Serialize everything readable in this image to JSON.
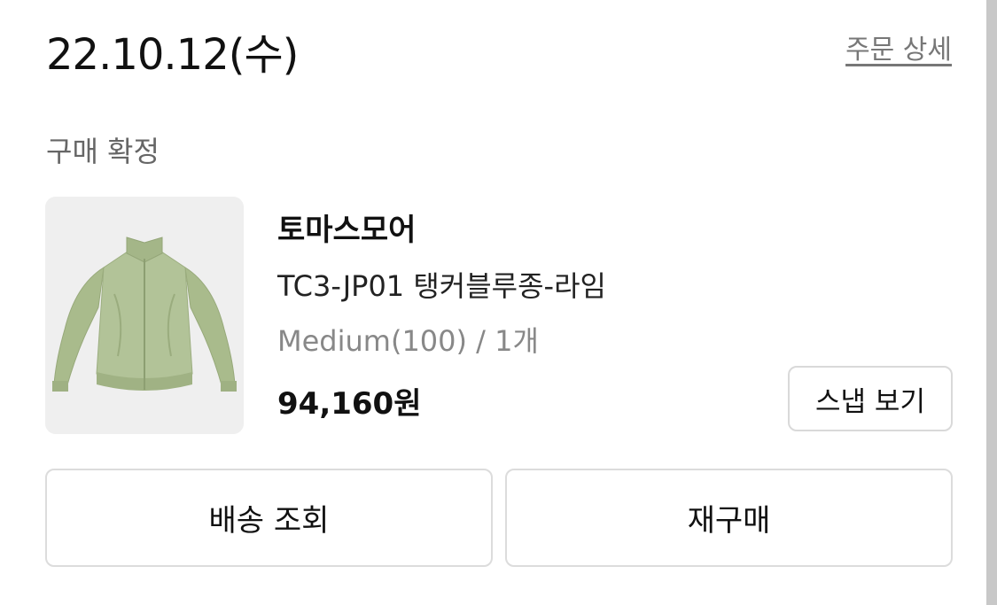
{
  "order": {
    "date": "22.10.12(수)",
    "detail_link": "주문 상세",
    "status": "구매 확정"
  },
  "product": {
    "image_icon": "jacket-image",
    "brand": "토마스모어",
    "name": "TC3-JP01 탱커블루종-라임",
    "option": "Medium(100) / 1개",
    "price": "94,160원",
    "snap_button": "스냅 보기",
    "jacket_color": "#aebf92"
  },
  "actions": {
    "tracking": "배송 조회",
    "reorder": "재구매"
  }
}
